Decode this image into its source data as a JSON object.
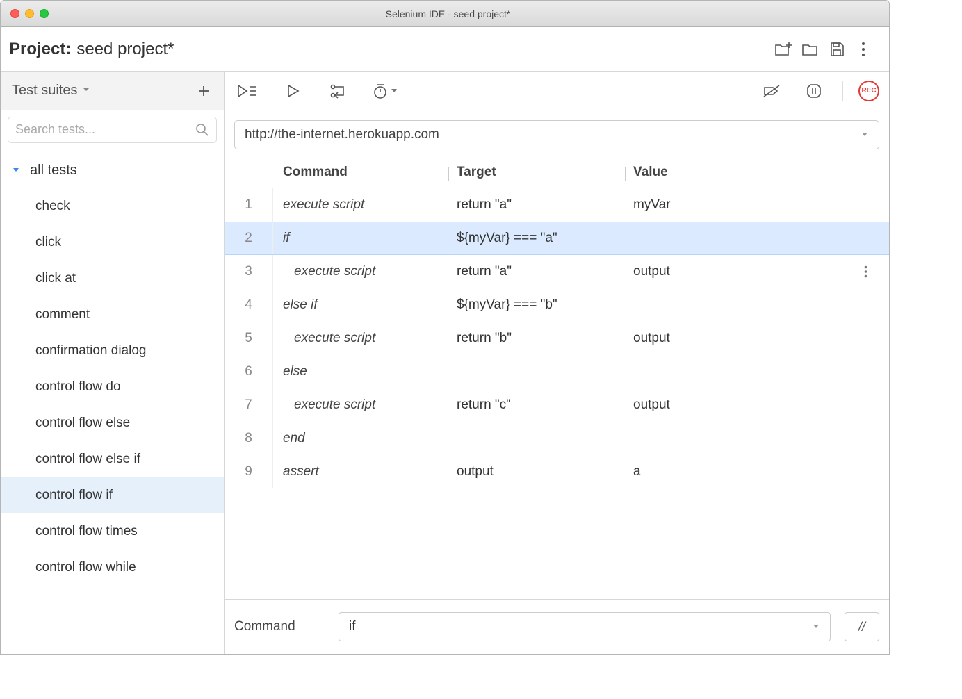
{
  "titlebar": {
    "title": "Selenium IDE - seed project*"
  },
  "project": {
    "label": "Project:",
    "name": "seed project*"
  },
  "sidebar": {
    "heading": "Test suites",
    "search_placeholder": "Search tests...",
    "suite": "all tests",
    "tests": [
      "check",
      "click",
      "click at",
      "comment",
      "confirmation dialog",
      "control flow do",
      "control flow else",
      "control flow else if",
      "control flow if",
      "control flow times",
      "control flow while"
    ],
    "selected_test": "control flow if"
  },
  "url": "http://the-internet.herokuapp.com",
  "columns": {
    "command": "Command",
    "target": "Target",
    "value": "Value"
  },
  "rows": [
    {
      "n": "1",
      "cmd": "execute script",
      "tgt": "return \"a\"",
      "val": "myVar",
      "indent": false
    },
    {
      "n": "2",
      "cmd": "if",
      "tgt": "${myVar} === \"a\"",
      "val": "",
      "indent": false,
      "selected": true
    },
    {
      "n": "3",
      "cmd": "execute script",
      "tgt": "return \"a\"",
      "val": "output",
      "indent": true,
      "showmenu": true
    },
    {
      "n": "4",
      "cmd": "else if",
      "tgt": "${myVar} === \"b\"",
      "val": "",
      "indent": false
    },
    {
      "n": "5",
      "cmd": "execute script",
      "tgt": "return \"b\"",
      "val": "output",
      "indent": true
    },
    {
      "n": "6",
      "cmd": "else",
      "tgt": "",
      "val": "",
      "indent": false
    },
    {
      "n": "7",
      "cmd": "execute script",
      "tgt": "return \"c\"",
      "val": "output",
      "indent": true
    },
    {
      "n": "8",
      "cmd": "end",
      "tgt": "",
      "val": "",
      "indent": false
    },
    {
      "n": "9",
      "cmd": "assert",
      "tgt": "output",
      "val": "a",
      "indent": false
    }
  ],
  "editor": {
    "label": "Command",
    "value": "if",
    "toggle": "//"
  },
  "rec": "REC"
}
